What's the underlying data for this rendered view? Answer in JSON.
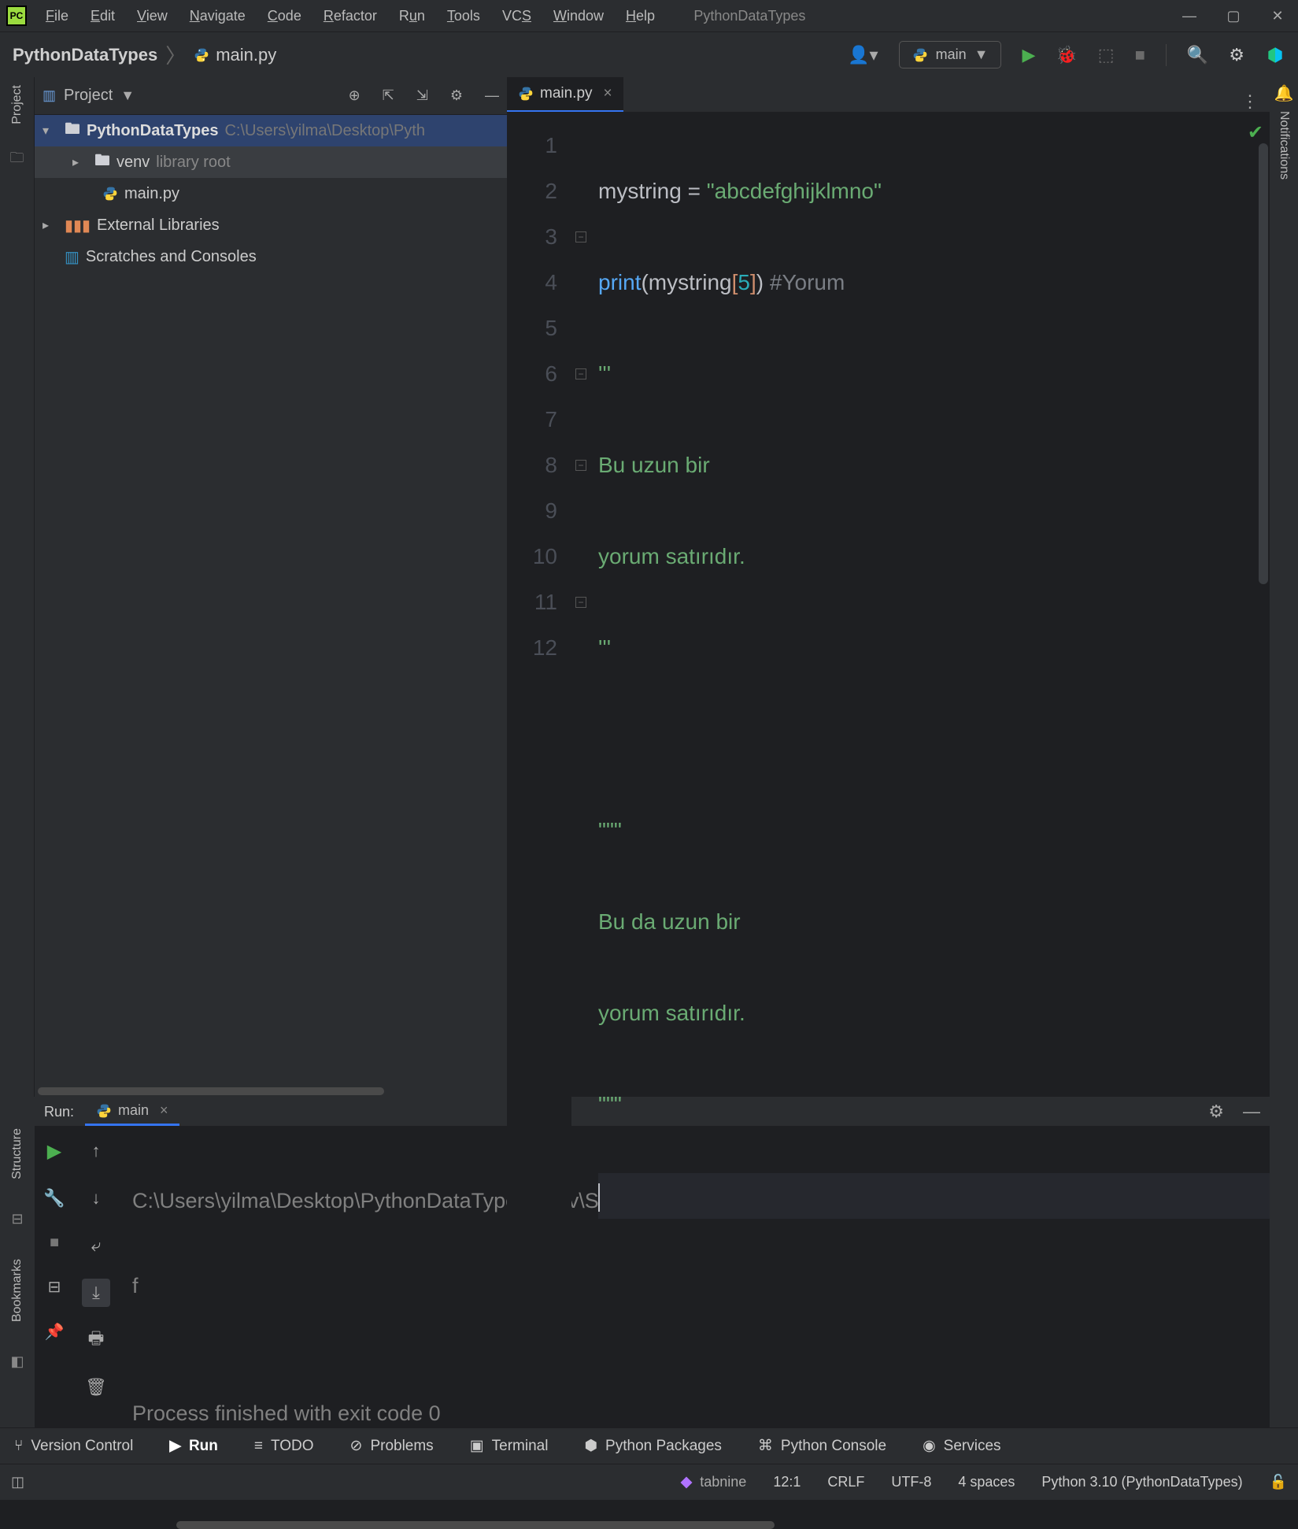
{
  "title": "PythonDataTypes",
  "menu": [
    "File",
    "Edit",
    "View",
    "Navigate",
    "Code",
    "Refactor",
    "Run",
    "Tools",
    "VCS",
    "Window",
    "Help"
  ],
  "breadcrumb": {
    "project": "PythonDataTypes",
    "file": "main.py"
  },
  "run_config": {
    "label": "main"
  },
  "project_panel": {
    "title": "Project",
    "root": {
      "name": "PythonDataTypes",
      "path": "C:\\Users\\yilma\\Desktop\\Pyth"
    },
    "venv": {
      "name": "venv",
      "hint": "library root"
    },
    "file": {
      "name": "main.py"
    },
    "ext": "External Libraries",
    "scratch": "Scratches and Consoles"
  },
  "editor": {
    "tab": "main.py",
    "lines": [
      "1",
      "2",
      "3",
      "4",
      "5",
      "6",
      "7",
      "8",
      "9",
      "10",
      "11",
      "12"
    ],
    "code": {
      "l1_var": "mystring",
      "l1_eq": " = ",
      "l1_str": "\"abcdefghijklmno\"",
      "l2_fn": "print",
      "l2_p1": "(",
      "l2_v": "mystring",
      "l2_b1": "[",
      "l2_n": "5",
      "l2_b2": "]",
      "l2_p2": ")",
      "l2_c": " #Yorum",
      "l3": "'''",
      "l4": "Bu uzun bir",
      "l5": "yorum satırıdır.",
      "l6": "'''",
      "l7": "",
      "l8": "\"\"\"",
      "l9": "Bu da uzun bir",
      "l10": "yorum satırıdır.",
      "l11": "\"\"\"",
      "l12": ""
    }
  },
  "run_panel": {
    "title": "Run:",
    "tab": "main",
    "console": {
      "l1": "C:\\Users\\yilma\\Desktop\\PythonDataTypes\\venv\\Scripts\\python.exe ",
      "l2": "f",
      "l3": "",
      "l4": "Process finished with exit code 0"
    }
  },
  "bottom_tools": {
    "vcs": "Version Control",
    "run": "Run",
    "todo": "TODO",
    "problems": "Problems",
    "terminal": "Terminal",
    "pkg": "Python Packages",
    "console": "Python Console",
    "services": "Services"
  },
  "status": {
    "tabnine": "tabnine",
    "pos": "12:1",
    "eol": "CRLF",
    "enc": "UTF-8",
    "indent": "4 spaces",
    "interp": "Python 3.10 (PythonDataTypes)"
  },
  "side": {
    "project": "Project",
    "structure": "Structure",
    "bookmarks": "Bookmarks",
    "notifications": "Notifications"
  }
}
